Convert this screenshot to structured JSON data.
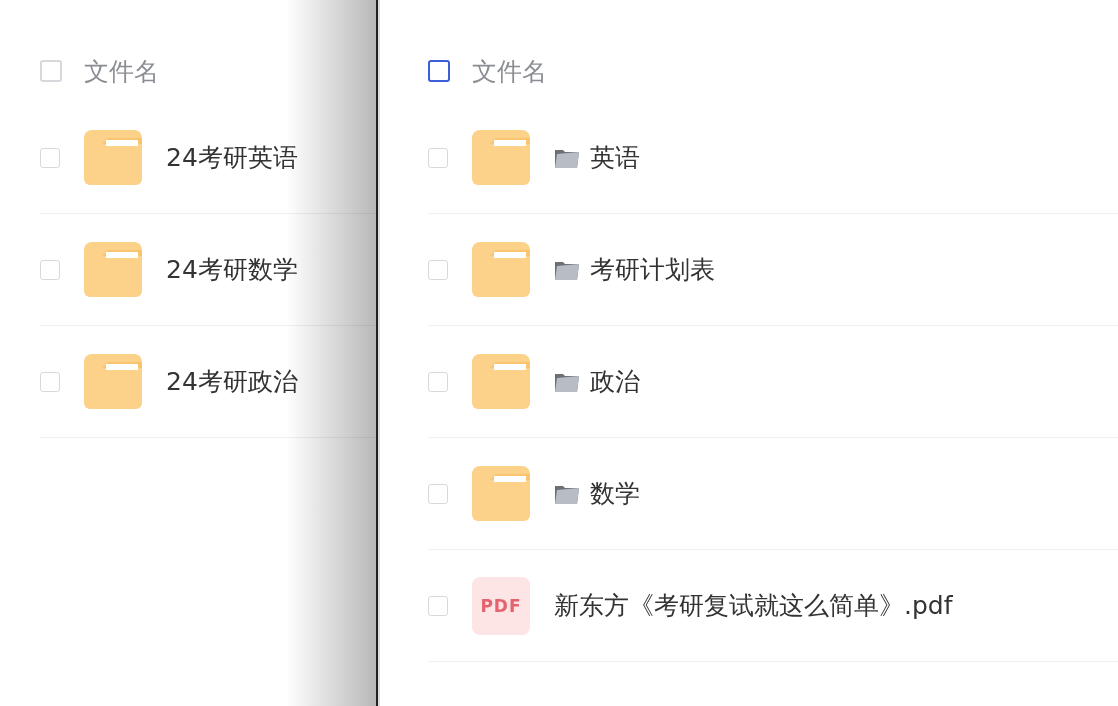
{
  "panels": [
    {
      "header": {
        "label": "文件名",
        "color": "#d6d8dc"
      },
      "rows": [
        {
          "kind": "folder",
          "name": "24考研英语",
          "checked": false,
          "prefix_icon": false
        },
        {
          "kind": "folder",
          "name": "24考研数学",
          "checked": false,
          "prefix_icon": false
        },
        {
          "kind": "folder",
          "name": "24考研政治",
          "checked": false,
          "prefix_icon": false
        }
      ]
    },
    {
      "header": {
        "label": "文件名",
        "color": "#3a5fd9"
      },
      "rows": [
        {
          "kind": "folder",
          "name": "英语",
          "checked": false,
          "prefix_icon": true
        },
        {
          "kind": "folder",
          "name": "考研计划表",
          "checked": false,
          "prefix_icon": true
        },
        {
          "kind": "folder",
          "name": "政治",
          "checked": false,
          "prefix_icon": true
        },
        {
          "kind": "folder",
          "name": "数学",
          "checked": false,
          "prefix_icon": true
        },
        {
          "kind": "pdf",
          "badge": "PDF",
          "name": "新东方《考研复试就这么简单》.pdf",
          "checked": false,
          "prefix_icon": false
        }
      ]
    }
  ]
}
